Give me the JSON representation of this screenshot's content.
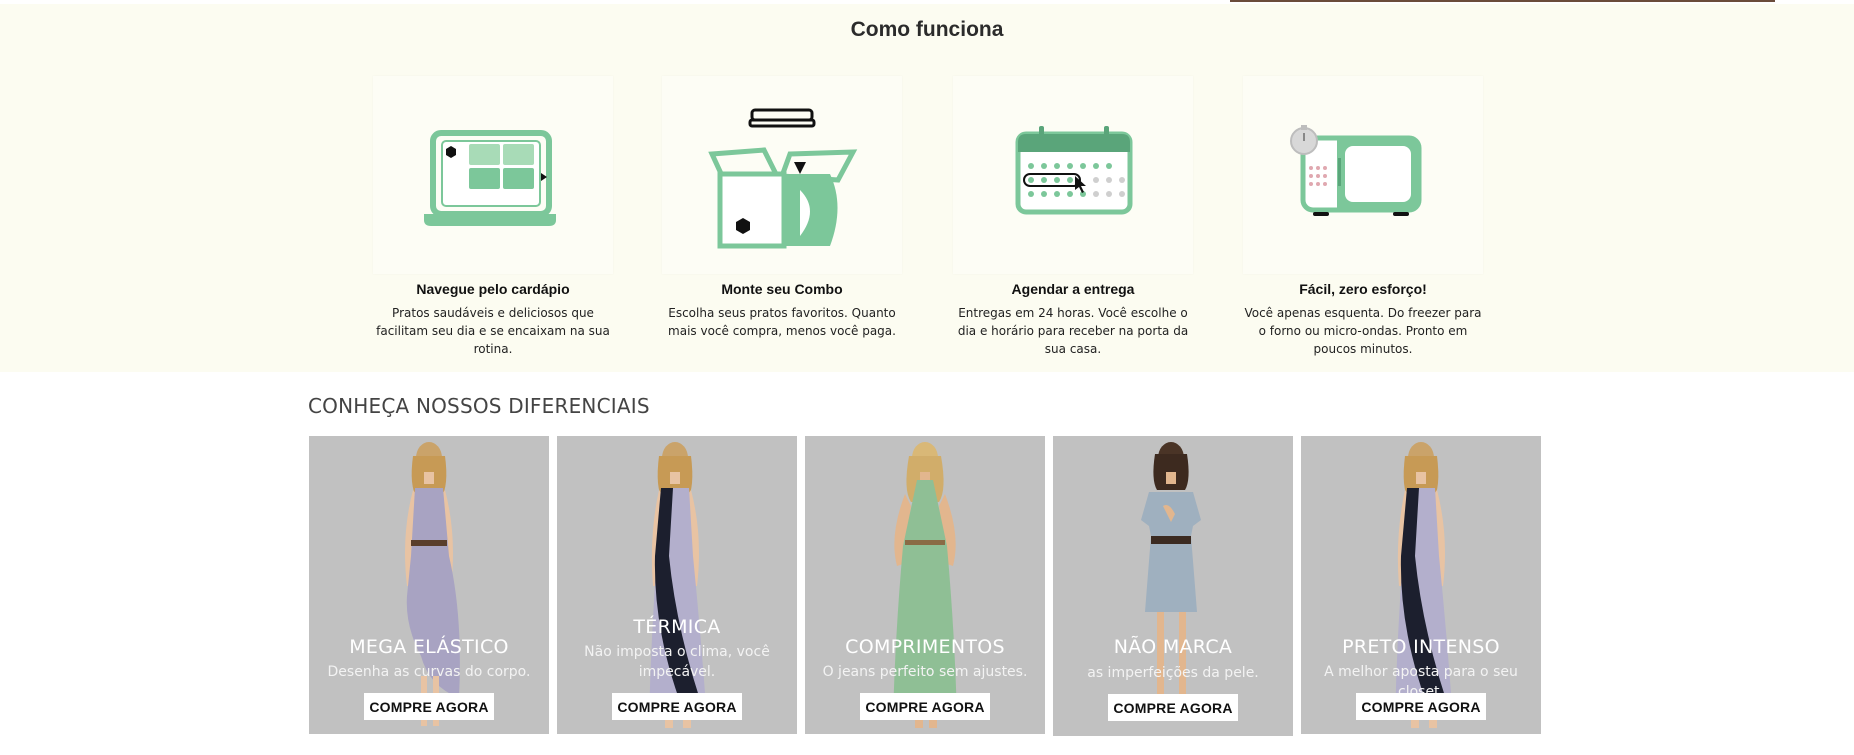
{
  "how_it_works": {
    "title": "Como funciona",
    "steps": [
      {
        "title": "Navegue pelo cardápio",
        "desc": "Pratos saudáveis e deliciosos que facilitam seu dia e se encaixam na sua rotina.",
        "icon": "laptop-menu-icon"
      },
      {
        "title": "Monte seu Combo",
        "desc": "Escolha seus pratos favoritos. Quanto mais você compra, menos você paga.",
        "icon": "box-combo-icon"
      },
      {
        "title": "Agendar a entrega",
        "desc": "Entregas em 24 horas. Você escolhe o dia e horário para receber na porta da sua casa.",
        "icon": "calendar-icon"
      },
      {
        "title": "Fácil, zero esforço!",
        "desc": "Você apenas esquenta. Do freezer para o forno ou micro-ondas. Pronto em poucos minutos.",
        "icon": "microwave-icon"
      }
    ]
  },
  "differentials": {
    "title": "CONHEÇA NOSSOS DIFERENCIAIS",
    "cards": [
      {
        "title": "MEGA ELÁSTICO",
        "subtitle": "Desenha as curvas do corpo.",
        "button": "COMPRE AGORA"
      },
      {
        "title": "TÉRMICA",
        "subtitle": "Não imposta o clima, você impecável.",
        "button": "COMPRE AGORA"
      },
      {
        "title": "COMPRIMENTOS",
        "subtitle": "O jeans perfeito sem ajustes.",
        "button": "COMPRE AGORA"
      },
      {
        "title": "NÃO MARCA",
        "subtitle": "as imperfeições da pele.",
        "button": "COMPRE AGORA"
      },
      {
        "title": "PRETO INTENSO",
        "subtitle": "A melhor aposta para o seu closet.",
        "button": "COMPRE AGORA"
      }
    ]
  },
  "colors": {
    "section_bg": "#fcfcf1",
    "icon_green": "#7cc79a",
    "icon_dark_green": "#5aa57a",
    "card_bg": "#c1c1c1"
  }
}
